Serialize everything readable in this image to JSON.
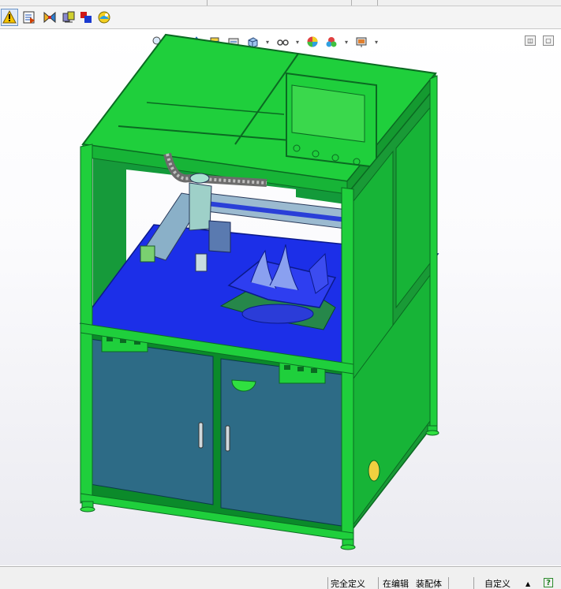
{
  "toolbar": {
    "icons": [
      "rebuild-warning-icon",
      "configuration-icon",
      "materials-icon",
      "assembly-icon",
      "appearance-icon",
      "scene-icon"
    ]
  },
  "heads_up": {
    "icons": [
      "zoom-to-fit-icon",
      "zoom-area-icon",
      "previous-view-icon",
      "section-view-icon",
      "dynamic-annotation-icon",
      "view-orientation-icon",
      "display-style-icon",
      "hide-show-icon",
      "edit-appearance-icon",
      "apply-scene-icon",
      "view-settings-icon"
    ]
  },
  "window_controls": {
    "restore_icon": "restore-icon",
    "maximize_icon": "maximize-icon"
  },
  "model": {
    "colors": {
      "frame": "#1fcf3c",
      "frame_dark": "#0e8a2c",
      "table": "#1c2fe8",
      "cabinet": "#2d6b86",
      "screen": "#3ad84c",
      "background": "#ffffff"
    }
  },
  "status": {
    "definition": "完全定义",
    "editing": "在编辑",
    "document_type": "装配体",
    "units": "自定义",
    "arrow": "▲",
    "help": "?"
  }
}
